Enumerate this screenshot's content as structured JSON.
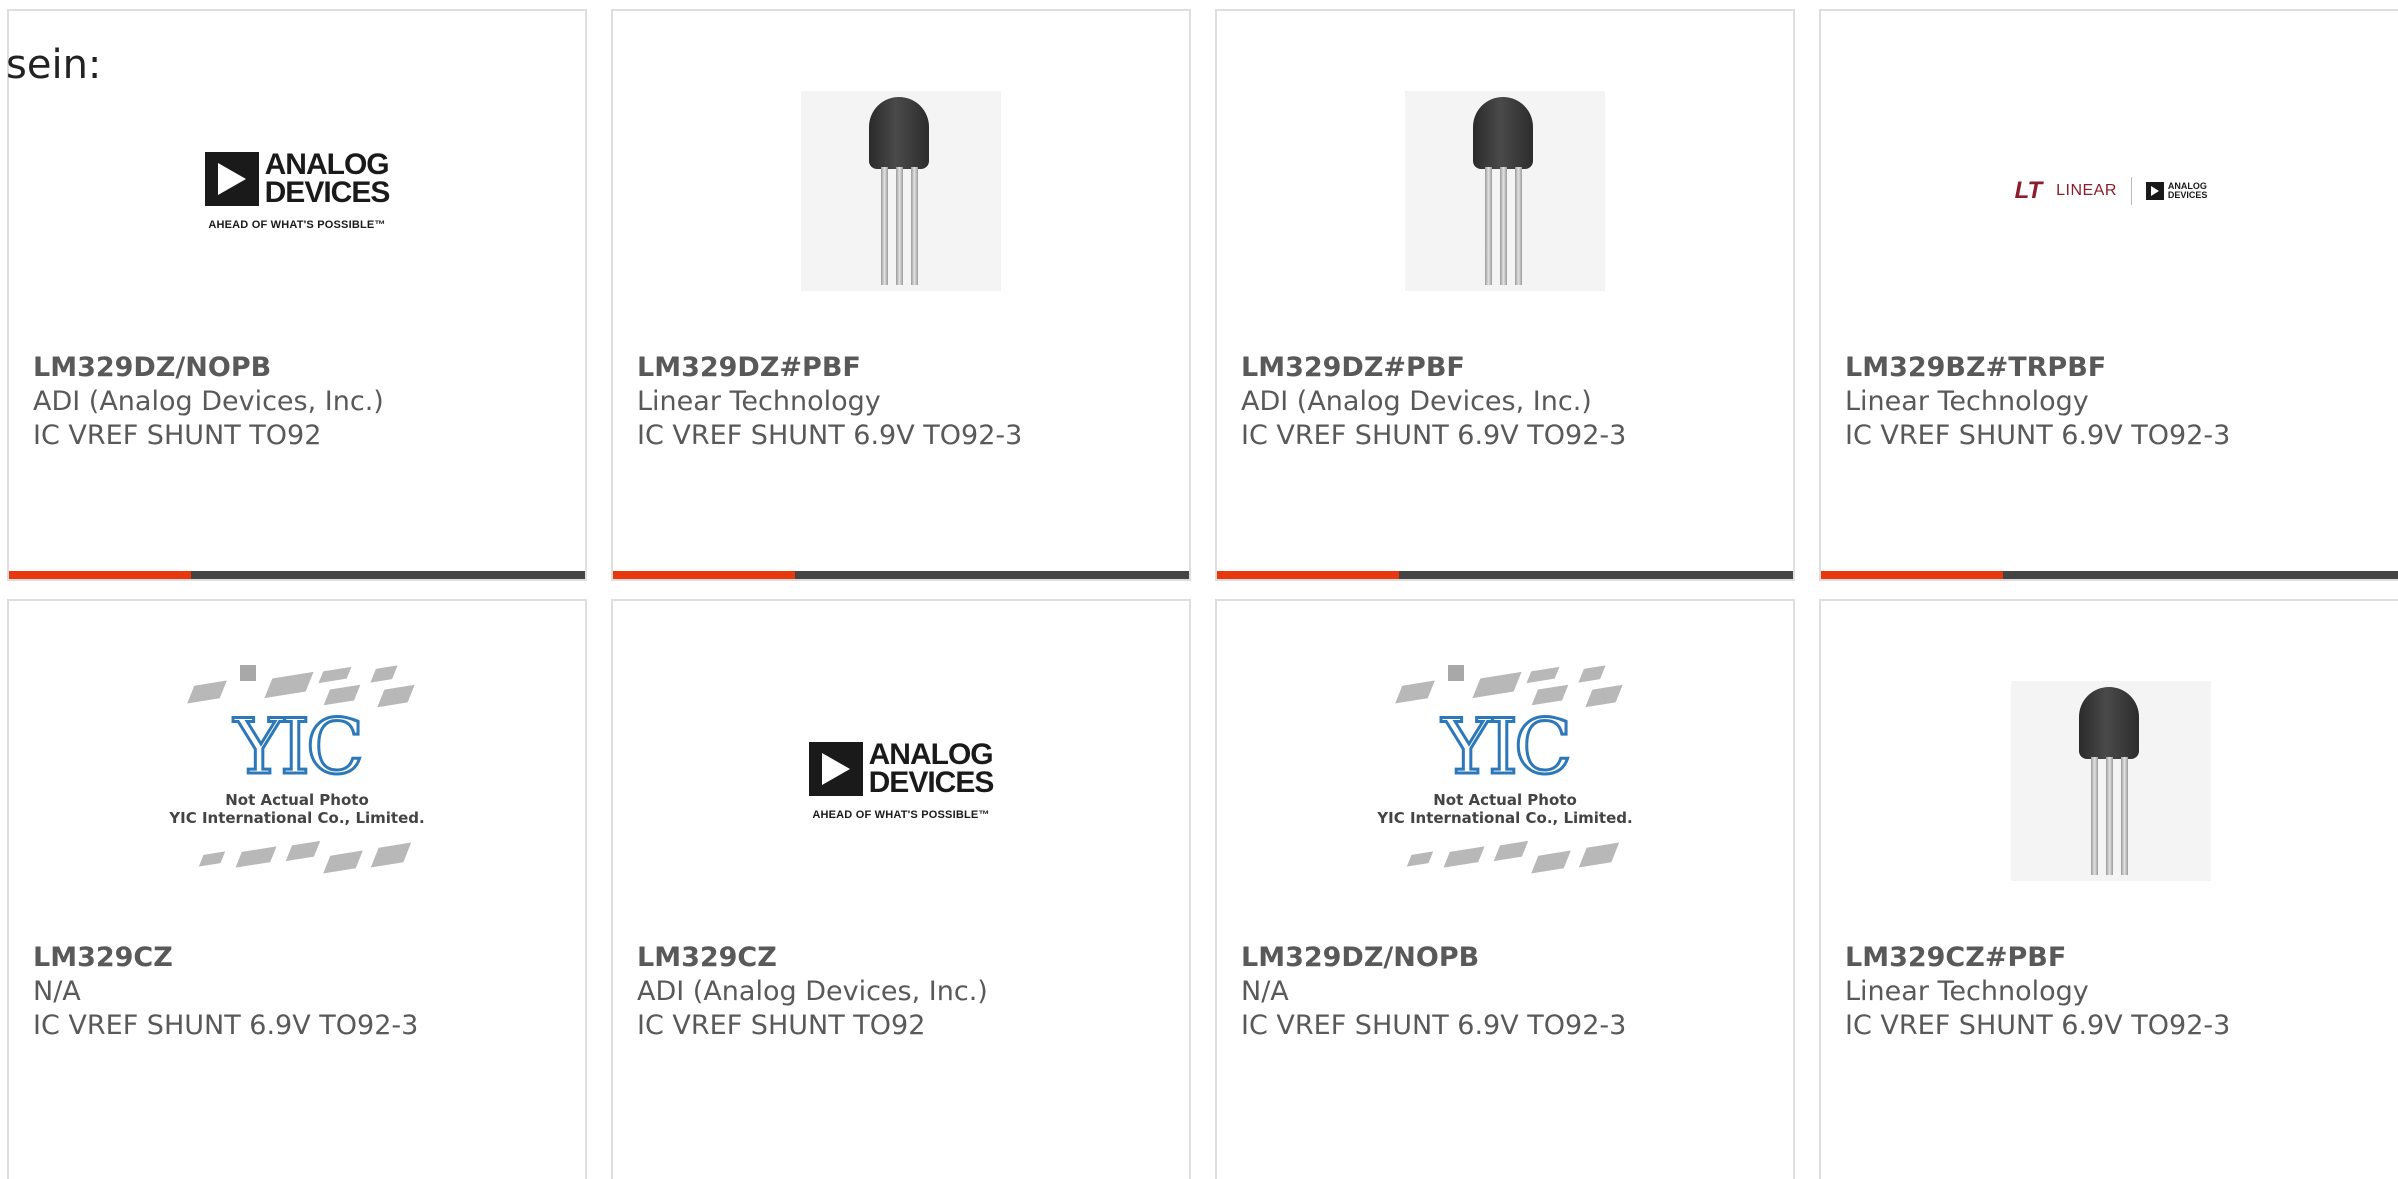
{
  "intro_text": "sein:",
  "colors": {
    "accent": "#e8380d",
    "bar": "#444444",
    "border": "#dedede",
    "text": "#595959"
  },
  "cards": [
    {
      "part_number": "LM329DZ/NOPB",
      "manufacturer": "ADI (Analog Devices, Inc.)",
      "description": "IC VREF SHUNT TO92",
      "image": "analog-devices-logo"
    },
    {
      "part_number": "LM329DZ#PBF",
      "manufacturer": "Linear Technology",
      "description": "IC VREF SHUNT 6.9V TO92-3",
      "image": "to92-transistor-photo"
    },
    {
      "part_number": "LM329DZ#PBF",
      "manufacturer": "ADI (Analog Devices, Inc.)",
      "description": "IC VREF SHUNT 6.9V TO92-3",
      "image": "to92-transistor-photo"
    },
    {
      "part_number": "LM329BZ#TRPBF",
      "manufacturer": "Linear Technology",
      "description": "IC VREF SHUNT 6.9V TO92-3",
      "image": "linear-analog-logo"
    },
    {
      "part_number": "LM329CZ",
      "manufacturer": "N/A",
      "description": "IC VREF SHUNT 6.9V TO92-3",
      "image": "yic-placeholder"
    },
    {
      "part_number": "LM329CZ",
      "manufacturer": "ADI (Analog Devices, Inc.)",
      "description": "IC VREF SHUNT TO92",
      "image": "analog-devices-logo"
    },
    {
      "part_number": "LM329DZ/NOPB",
      "manufacturer": "N/A",
      "description": "IC VREF SHUNT 6.9V TO92-3",
      "image": "yic-placeholder"
    },
    {
      "part_number": "LM329CZ#PBF",
      "manufacturer": "Linear Technology",
      "description": "IC VREF SHUNT 6.9V TO92-3",
      "image": "to92-transistor-photo"
    }
  ],
  "logos": {
    "adi_line1": "ANALOG",
    "adi_line2": "DEVICES",
    "adi_tagline": "AHEAD OF WHAT'S POSSIBLE™",
    "linear_mark": "LT",
    "linear_word": "LINEAR",
    "yic_mark": "YIC",
    "yic_line1": "Not Actual Photo",
    "yic_line2": "YIC International Co., Limited."
  }
}
